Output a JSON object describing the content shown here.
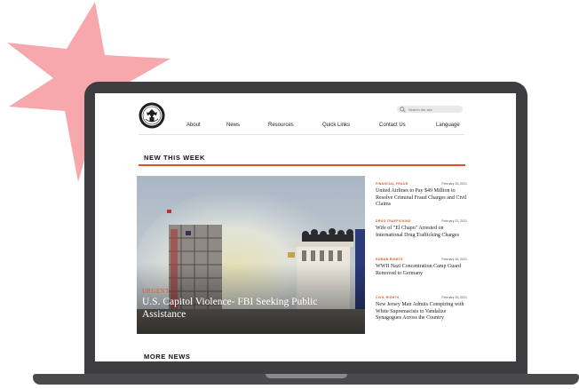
{
  "colors": {
    "accent": "#d9541e",
    "burst": "#f6a8ad",
    "laptop": "#3e3e40"
  },
  "header": {
    "search_placeholder": "Search the site",
    "nav": [
      "About",
      "News",
      "Resources",
      "Quick Links",
      "Contact Us",
      "Language"
    ]
  },
  "section_title": "NEW THIS WEEK",
  "hero": {
    "tag": "URGENT",
    "headline": "U.S. Capitol Violence- FBI Seeking Public Assistance"
  },
  "stories": [
    {
      "category": "FINANCIAL FRAUD",
      "date": "February 26, 2021",
      "title": "United Airlines to Pay $49 Million to Resolve Criminal Fraud Charges and Civil Claims"
    },
    {
      "category": "DRUG TRAFFICKING",
      "date": "February 22, 2021",
      "title": "Wife of \"El Chapo\" Arrested on International Drug Trafficking Charges"
    },
    {
      "category": "HUMAN RIGHTS",
      "date": "February 26, 2021",
      "title": "WWII Nazi Concentration Camp Guard Removed to Germany"
    },
    {
      "category": "CIVIL RIGHTS",
      "date": "February 26, 2021",
      "title": "New Jersey Man Admits Conspiring with White Supremacists to Vandalize Synagogues Across the Country"
    }
  ],
  "more_title": "MORE NEWS"
}
